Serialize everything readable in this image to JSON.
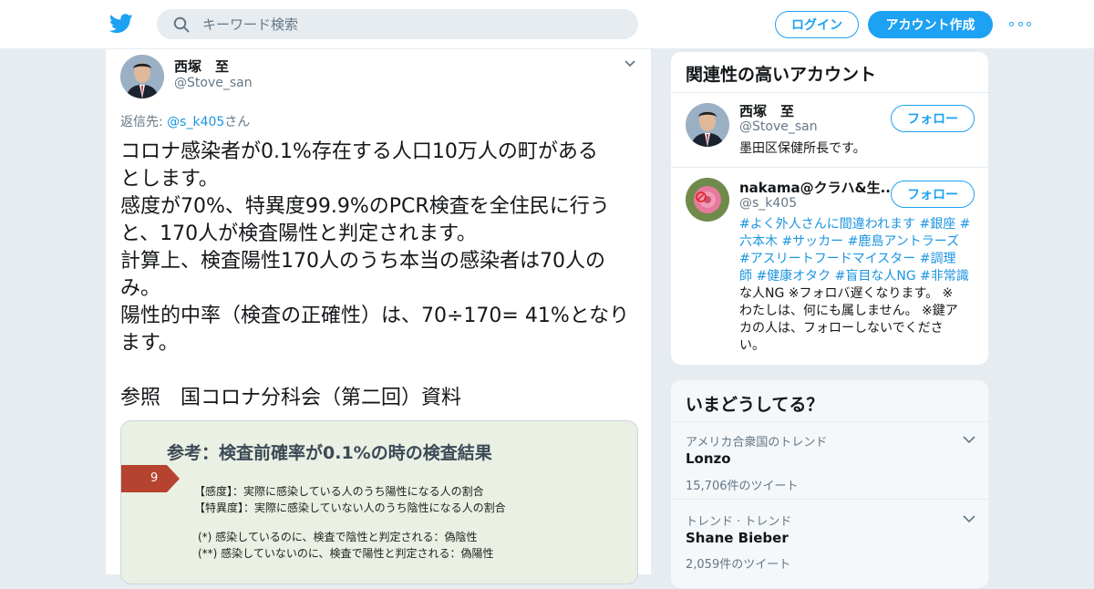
{
  "header": {
    "search_placeholder": "キーワード検索",
    "login_label": "ログイン",
    "signup_label": "アカウント作成",
    "brand_color": "#1da1f2"
  },
  "tweet": {
    "author_name": "西塚　至",
    "author_handle": "@Stove_san",
    "reply_prefix": "返信先: ",
    "reply_mention": "@s_k405",
    "reply_suffix": "さん",
    "body_lines": [
      "コロナ感染者が0.1%存在する人口10万人の町がある",
      "とします。",
      "感度が70%、特異度99.9%のPCR検査を全住民に行う",
      "と、170人が検査陽性と判定されます。",
      "計算上、検査陽性170人のうち本当の感染者は70人の",
      "み。",
      "陽性的中率（検査の正確性）は、70÷170= 41%となり",
      "ます。"
    ],
    "body_ref": "参照　国コロナ分科会（第二回）資料",
    "media": {
      "title": "参考：検査前確率が0.1%の時の検査結果",
      "badge_number": "9",
      "line1": "【感度】：実際に感染している人のうち陽性になる人の割合",
      "line2": "【特異度】：実際に感染していない人のうち陰性になる人の割合",
      "line3": "(*) 感染しているのに、検査で陰性と判定される：偽陰性",
      "line4": "(**) 感染していないのに、検査で陽性と判定される：偽陽性"
    }
  },
  "related": {
    "title": "関連性の高いアカウント",
    "follow_label": "フォロー",
    "accounts": [
      {
        "name": "西塚　至",
        "handle": "@Stove_san",
        "bio": "墨田区保健所長です。"
      },
      {
        "name": "nakama@クラハ&生...",
        "handle": "@s_k405",
        "bio_lines": [
          "#よく外人さんに間違われます #銀座 #",
          "六本木 #サッカー #鹿島アントラーズ",
          "#アスリートフードマイスター #調理",
          "師 #健康オタク #盲目な人NG #非常識",
          "な人NG ※フォロバ遅くなります。 ※",
          "わたしは、何にも属しません。 ※鍵ア",
          "カの人は、フォローしないでくださ",
          "い。"
        ]
      }
    ]
  },
  "trends": {
    "title": "いまどうしてる？",
    "items": [
      {
        "context": "アメリカ合衆国のトレンド",
        "name": "Lonzo",
        "count": "15,706件のツイート"
      },
      {
        "context": "トレンド · トレンド",
        "name": "Shane Bieber",
        "count": "2,059件のツイート"
      }
    ]
  }
}
